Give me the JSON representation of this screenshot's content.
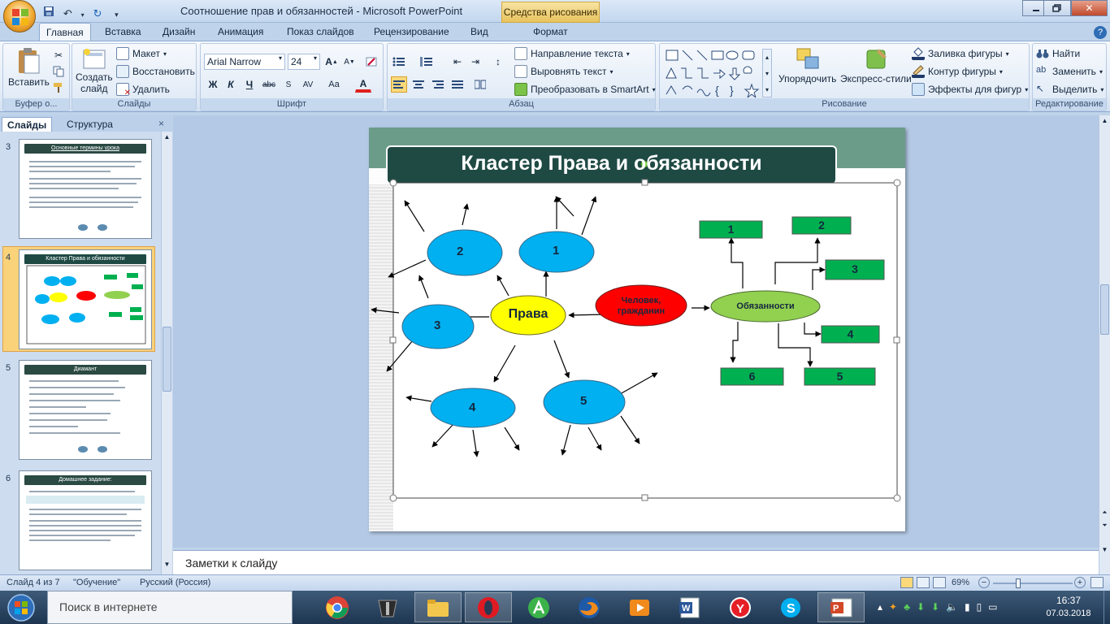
{
  "window": {
    "title": "Соотношение прав и обязанностей - Microsoft PowerPoint",
    "context_tab_title": "Средства рисования"
  },
  "ribbon_tabs": [
    "Главная",
    "Вставка",
    "Дизайн",
    "Анимация",
    "Показ слайдов",
    "Рецензирование",
    "Вид",
    "Формат"
  ],
  "ribbon": {
    "clipboard": {
      "paste": "Вставить",
      "label": "Буфер о..."
    },
    "slides": {
      "new_slide_1": "Создать",
      "new_slide_2": "слайд",
      "layout": "Макет",
      "reset": "Восстановить",
      "delete": "Удалить",
      "label": "Слайды"
    },
    "font": {
      "font_name": "Arial Narrow",
      "font_size": "24",
      "label": "Шрифт",
      "bold": "Ж",
      "italic": "К",
      "underline": "Ч",
      "strike": "abc",
      "spacing": "AV",
      "case": "Aa",
      "color": "A"
    },
    "paragraph": {
      "text_direction": "Направление текста",
      "align_text": "Выровнять текст",
      "smartart": "Преобразовать в SmartArt",
      "label": "Абзац"
    },
    "drawing": {
      "arrange": "Упорядочить",
      "quick_styles": "Экспресс-стили",
      "fill": "Заливка фигуры",
      "outline": "Контур фигуры",
      "effects": "Эффекты для фигур",
      "label": "Рисование"
    },
    "editing": {
      "find": "Найти",
      "replace": "Заменить",
      "select": "Выделить",
      "label": "Редактирование"
    }
  },
  "left_pane": {
    "tab_slides": "Слайды",
    "tab_outline": "Структура",
    "thumbnails": [
      {
        "number": "3",
        "title": "Основные термины урока"
      },
      {
        "number": "4",
        "title": "Кластер Права и обязанности"
      },
      {
        "number": "5",
        "title": "Диамант"
      },
      {
        "number": "6",
        "title": "Домашнее задание:"
      }
    ]
  },
  "slide": {
    "title": "Кластер Права и обязанности",
    "center_rights": "Права",
    "person_line1": "Человек,",
    "person_line2": "гражданин",
    "duties": "Обязанности",
    "rights_nodes": [
      "1",
      "2",
      "3",
      "4",
      "5"
    ],
    "duty_nodes": [
      "1",
      "2",
      "3",
      "4",
      "5",
      "6"
    ],
    "colors": {
      "title_bar": "#1f4a44",
      "header_band": "#6b9c8a",
      "ellipse_blue": "#00b0f0",
      "rights_yellow": "#ffff00",
      "person_red": "#ff0000",
      "duties_green": "#92d050",
      "duty_box": "#00b050"
    }
  },
  "notes": {
    "placeholder": "Заметки к слайду"
  },
  "status": {
    "slide_counter": "Слайд 4 из 7",
    "theme": "\"Обучение\"",
    "language": "Русский (Россия)",
    "zoom": "69%"
  },
  "taskbar": {
    "search_placeholder": "Поиск в интернете",
    "time": "16:37",
    "date": "07.03.2018"
  }
}
